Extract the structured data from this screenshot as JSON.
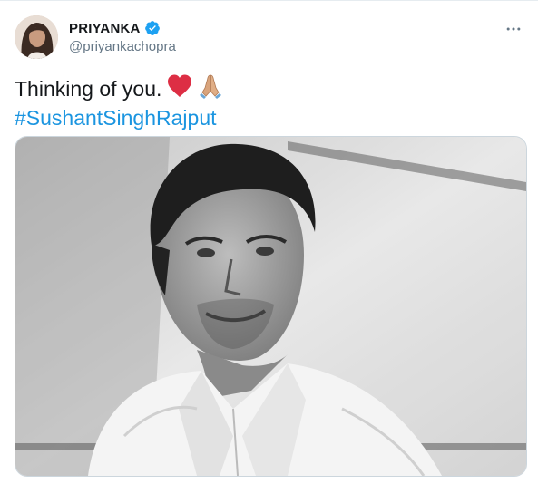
{
  "tweet": {
    "author": {
      "display_name": "PRIYANKA",
      "handle": "@priyankachopra",
      "verified": true
    },
    "text": "Thinking of you.",
    "emojis": [
      "red-heart",
      "folded-hands"
    ],
    "hashtag": "#SushantSinghRajput",
    "media": {
      "type": "photo",
      "color_mode": "black-and-white"
    }
  },
  "colors": {
    "text": "#14171a",
    "secondary": "#657786",
    "link": "#1b95e0",
    "verified_badge": "#1da1f2",
    "heart": "#e0245e"
  },
  "icons": {
    "verified": "verified-badge-icon",
    "more": "more-horizontal-icon"
  }
}
